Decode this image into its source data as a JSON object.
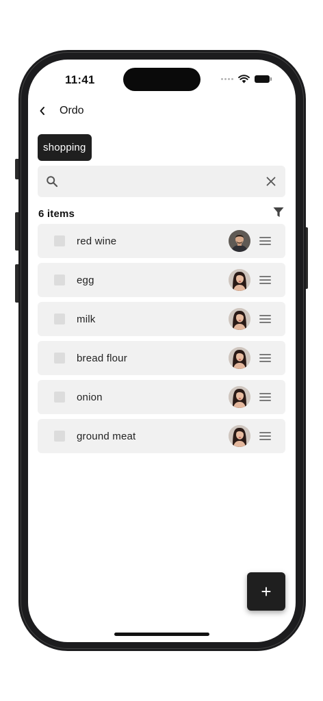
{
  "status_bar": {
    "time": "11:41",
    "icons": [
      "signal-dots-icon",
      "wifi-icon",
      "battery-icon"
    ]
  },
  "nav": {
    "back_icon": "chevron-left-icon",
    "title": "Ordo"
  },
  "tag": {
    "label": "shopping"
  },
  "search": {
    "value": "",
    "placeholder": "",
    "search_icon": "search-icon",
    "clear_icon": "close-icon"
  },
  "list_header": {
    "count_label": "6 items",
    "filter_icon": "filter-icon"
  },
  "items": [
    {
      "label": "red wine",
      "checked": false,
      "assignee": "man-avatar"
    },
    {
      "label": "egg",
      "checked": false,
      "assignee": "woman-avatar"
    },
    {
      "label": "milk",
      "checked": false,
      "assignee": "woman-avatar"
    },
    {
      "label": "bread flour",
      "checked": false,
      "assignee": "woman-avatar"
    },
    {
      "label": "onion",
      "checked": false,
      "assignee": "woman-avatar"
    },
    {
      "label": "ground meat",
      "checked": false,
      "assignee": "woman-avatar"
    }
  ],
  "fab": {
    "icon": "plus-icon",
    "label": "+"
  },
  "colors": {
    "accent_dark": "#1f1f1f",
    "row_bg": "#f1f1f1",
    "search_bg": "#f0f0f0",
    "checkbox": "#dcdcdc"
  }
}
